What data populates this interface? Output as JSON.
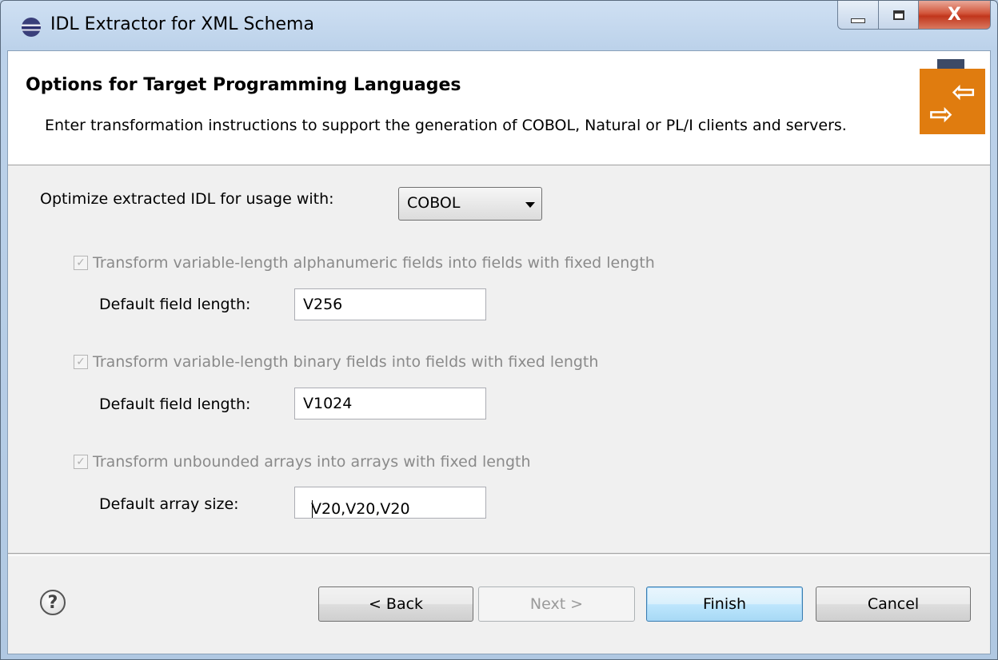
{
  "window": {
    "title": "IDL Extractor for XML Schema"
  },
  "caption_buttons": {
    "close_glyph": "X"
  },
  "header": {
    "title": "Options for Target Programming Languages",
    "description": "Enter transformation instructions to support the generation of COBOL, Natural or PL/I clients and servers.",
    "banner_colors": {
      "orange": "#e07c0f",
      "dark": "#3c4a66"
    }
  },
  "optimize": {
    "label": "Optimize extracted IDL for usage with:",
    "selected": "COBOL"
  },
  "options": [
    {
      "checkbox_label": "Transform variable-length alphanumeric fields into fields with fixed length",
      "checked": true,
      "enabled": false,
      "field_label": "Default field length:",
      "field_value": "V256"
    },
    {
      "checkbox_label": "Transform variable-length binary fields into fields with fixed length",
      "checked": true,
      "enabled": false,
      "field_label": "Default field length:",
      "field_value": "V1024"
    },
    {
      "checkbox_label": "Transform unbounded arrays into arrays with fixed length",
      "checked": true,
      "enabled": false,
      "field_label": "Default array size:",
      "field_value": "V20,V20,V20"
    }
  ],
  "footer": {
    "help_glyph": "?",
    "back": "< Back",
    "next": "Next >",
    "finish": "Finish",
    "cancel": "Cancel"
  }
}
